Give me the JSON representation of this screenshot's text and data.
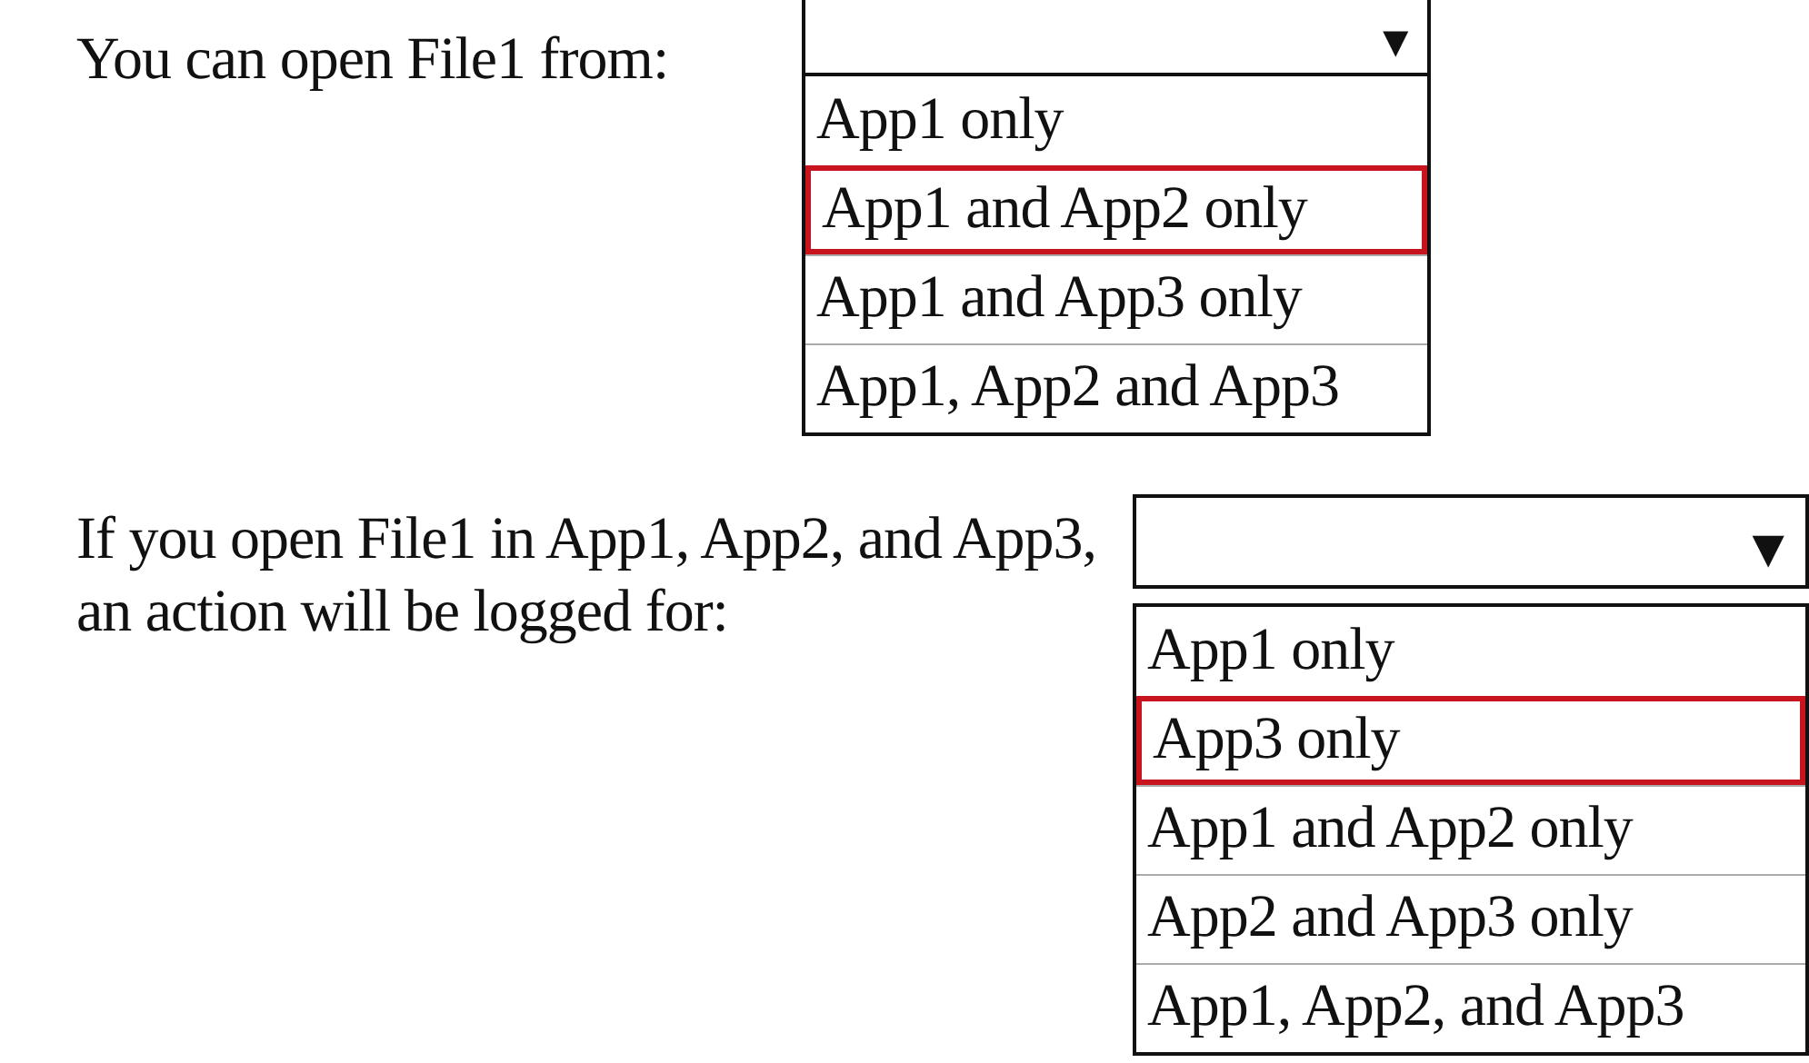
{
  "questions": [
    {
      "prompt": "You can open File1 from:",
      "arrow": "▼",
      "options": [
        {
          "label": "App1 only",
          "selected": false
        },
        {
          "label": "App1 and App2 only",
          "selected": true
        },
        {
          "label": "App1 and App3 only",
          "selected": false
        },
        {
          "label": "App1, App2 and App3",
          "selected": false
        }
      ]
    },
    {
      "prompt": "If you open File1 in App1, App2, and App3, an action will be logged for:",
      "arrow": "▼",
      "options": [
        {
          "label": "App1 only",
          "selected": false
        },
        {
          "label": "App3 only",
          "selected": true
        },
        {
          "label": "App1 and App2 only",
          "selected": false
        },
        {
          "label": "App2 and App3 only",
          "selected": false
        },
        {
          "label": "App1, App2, and App3",
          "selected": false
        }
      ]
    }
  ]
}
